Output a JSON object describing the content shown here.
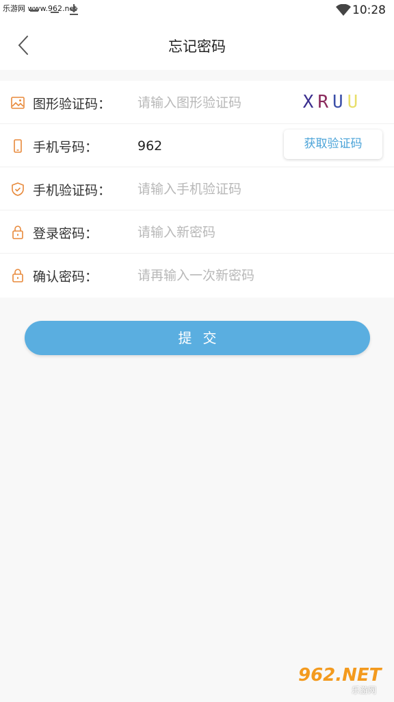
{
  "status_bar": {
    "watermark": "乐游网 www.962.net",
    "time": "10:28"
  },
  "header": {
    "title": "忘记密码",
    "back_icon": "chevron-left-icon"
  },
  "form": {
    "rows": [
      {
        "icon": "image-icon",
        "label": "图形验证码：",
        "placeholder": "请输入图形验证码",
        "value": ""
      },
      {
        "icon": "phone-icon",
        "label": "手机号码：",
        "placeholder": "",
        "value": "962"
      },
      {
        "icon": "shield-icon",
        "label": "手机验证码：",
        "placeholder": "请输入手机验证码",
        "value": ""
      },
      {
        "icon": "lock-icon",
        "label": "登录密码：",
        "placeholder": "请输入新密码",
        "value": ""
      },
      {
        "icon": "lock-icon",
        "label": "确认密码：",
        "placeholder": "请再输入一次新密码",
        "value": ""
      }
    ],
    "captcha_text": [
      "X",
      "R",
      "U",
      "U"
    ],
    "get_code_label": "获取验证码"
  },
  "submit_label": "提交",
  "watermark_logo": {
    "brand": "962.NET",
    "name": "乐游网"
  },
  "colors": {
    "accent": "#5aaee0",
    "icon_orange": "#e8893a",
    "link_blue": "#4aa3d8"
  }
}
